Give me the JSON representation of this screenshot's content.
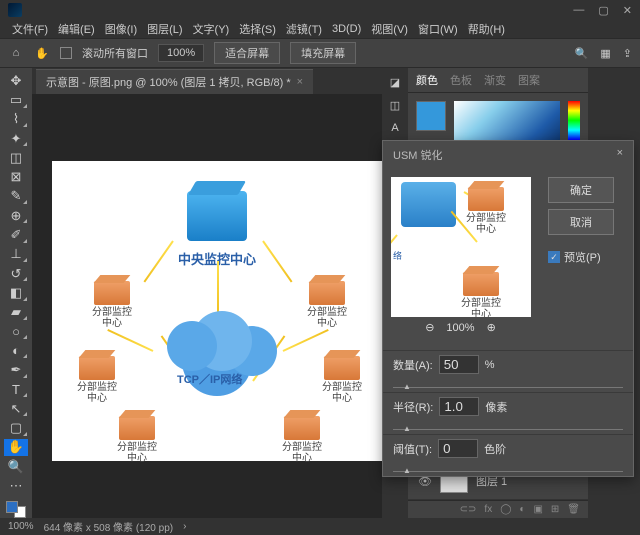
{
  "menus": [
    "文件(F)",
    "编辑(E)",
    "图像(I)",
    "图层(L)",
    "文字(Y)",
    "选择(S)",
    "滤镜(T)",
    "3D(D)",
    "视图(V)",
    "窗口(W)",
    "帮助(H)"
  ],
  "options": {
    "scroll_all": "滚动所有窗口",
    "zoom": "100%",
    "fit_screen": "适合屏幕",
    "fill_screen": "填充屏幕"
  },
  "tab": {
    "title": "示意图 - 原图.png @ 100% (图层 1 拷贝, RGB/8) *"
  },
  "artwork": {
    "center_label": "中央监控中心",
    "cloud_label": "TCP／IP网络",
    "branch_label": "分部监控\n中心"
  },
  "color_panel": {
    "tabs": [
      "颜色",
      "色板",
      "渐变",
      "图案"
    ]
  },
  "dialog": {
    "title": "USM 锐化",
    "ok": "确定",
    "cancel": "取消",
    "preview_chk": "预览(P)",
    "zoom": "100%",
    "amount_label": "数量(A):",
    "amount_val": "50",
    "amount_unit": "%",
    "radius_label": "半径(R):",
    "radius_val": "1.0",
    "radius_unit": "像素",
    "thresh_label": "阈值(T):",
    "thresh_val": "0",
    "thresh_unit": "色阶"
  },
  "layers": {
    "name": "图层 1"
  },
  "status": {
    "zoom": "100%",
    "docinfo": "644 像素 x 508 像素 (120 pp)"
  }
}
